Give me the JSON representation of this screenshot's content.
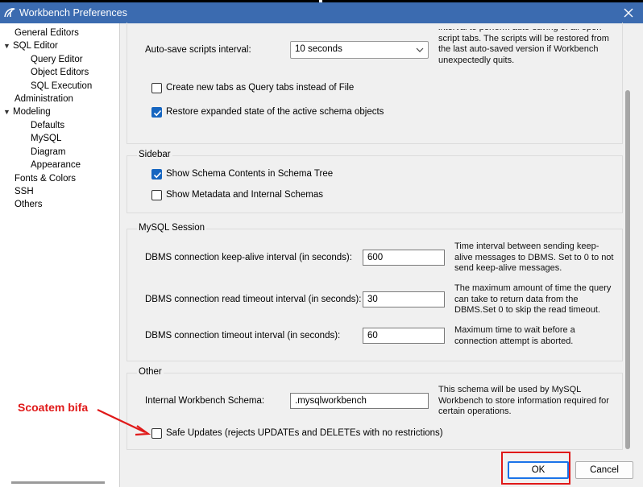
{
  "window": {
    "title": "Workbench Preferences"
  },
  "sidebar": {
    "items": [
      {
        "label": "General Editors"
      },
      {
        "label": "SQL Editor"
      },
      {
        "label": "Query Editor"
      },
      {
        "label": "Object Editors"
      },
      {
        "label": "SQL Execution"
      },
      {
        "label": "Administration"
      },
      {
        "label": "Modeling"
      },
      {
        "label": "Defaults"
      },
      {
        "label": "MySQL"
      },
      {
        "label": "Diagram"
      },
      {
        "label": "Appearance"
      },
      {
        "label": "Fonts & Colors"
      },
      {
        "label": "SSH"
      },
      {
        "label": "Others"
      }
    ]
  },
  "top": {
    "autosave_label": "Auto-save scripts interval:",
    "autosave_value": "10 seconds",
    "autosave_note": "interval to perform auto-saving of all open script tabs. The scripts will be restored from the last auto-saved version if Workbench unexpectedly quits.",
    "new_tabs_label": "Create new tabs as Query tabs instead of File",
    "new_tabs_checked": false,
    "restore_label": "Restore expanded state of the active schema objects",
    "restore_checked": true
  },
  "sidebar_group": {
    "title": "Sidebar",
    "show_schema_label": "Show Schema Contents in Schema Tree",
    "show_schema_checked": true,
    "show_metadata_label": "Show Metadata and Internal Schemas",
    "show_metadata_checked": false
  },
  "session": {
    "title": "MySQL Session",
    "keepalive_label": "DBMS connection keep-alive interval (in seconds):",
    "keepalive_value": "600",
    "keepalive_note": "Time interval between sending keep-alive messages to DBMS. Set to 0 to not send keep-alive messages.",
    "read_timeout_label": "DBMS connection read timeout interval (in seconds):",
    "read_timeout_value": "30",
    "read_timeout_note": "The maximum amount of time the query can take to return data from the DBMS.Set 0 to skip the read timeout.",
    "conn_timeout_label": "DBMS connection timeout interval (in seconds):",
    "conn_timeout_value": "60",
    "conn_timeout_note": "Maximum time to wait before a connection attempt is aborted."
  },
  "other": {
    "title": "Other",
    "schema_label": "Internal Workbench Schema:",
    "schema_value": ".mysqlworkbench",
    "schema_note": "This schema will be used by MySQL Workbench to store information required for certain operations.",
    "safe_updates_label": "Safe Updates (rejects UPDATEs and DELETEs with no restrictions)",
    "safe_updates_checked": false
  },
  "buttons": {
    "ok": "OK",
    "cancel": "Cancel"
  },
  "annotation": {
    "text": "Scoatem bifa"
  },
  "colors": {
    "titlebar": "#3b6bb0",
    "accent": "#1565c0",
    "annotation": "#e01919"
  }
}
